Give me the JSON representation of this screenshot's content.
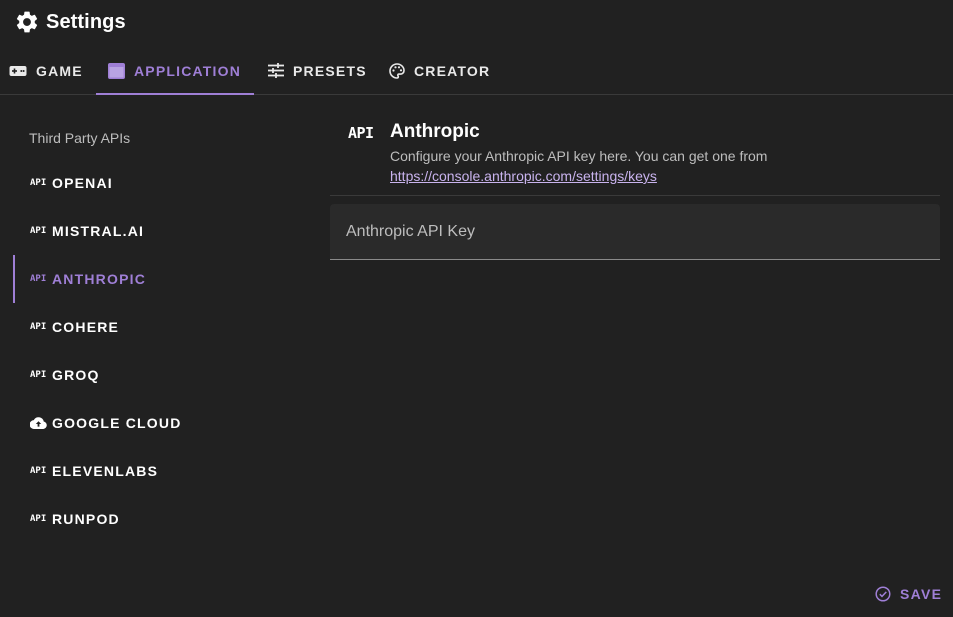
{
  "window": {
    "title": "Settings"
  },
  "tabs": [
    {
      "label": "GAME",
      "icon": "gamepad-icon"
    },
    {
      "label": "APPLICATION",
      "icon": "application-window-icon",
      "active": true
    },
    {
      "label": "PRESETS",
      "icon": "sliders-icon"
    },
    {
      "label": "CREATOR",
      "icon": "palette-icon"
    }
  ],
  "sidebar": {
    "header": "Third Party APIs",
    "items": [
      {
        "label": "OPENAI",
        "icon": "api-icon",
        "icon_text": "API"
      },
      {
        "label": "MISTRAL.AI",
        "icon": "api-icon",
        "icon_text": "API"
      },
      {
        "label": "ANTHROPIC",
        "icon": "api-icon",
        "icon_text": "API",
        "active": true
      },
      {
        "label": "COHERE",
        "icon": "api-icon",
        "icon_text": "API"
      },
      {
        "label": "GROQ",
        "icon": "api-icon",
        "icon_text": "API"
      },
      {
        "label": "GOOGLE CLOUD",
        "icon": "cloud-upload-icon"
      },
      {
        "label": "ELEVENLABS",
        "icon": "api-icon",
        "icon_text": "API"
      },
      {
        "label": "RUNPOD",
        "icon": "api-icon",
        "icon_text": "API"
      }
    ]
  },
  "content": {
    "icon_text": "API",
    "title": "Anthropic",
    "description": "Configure your Anthropic API key here. You can get one from",
    "link": "https://console.anthropic.com/settings/keys",
    "field": {
      "placeholder": "Anthropic API Key",
      "value": ""
    }
  },
  "footer": {
    "save_label": "SAVE"
  },
  "colors": {
    "accent": "#9f7fd6",
    "background": "#212121",
    "field_bg": "#2a2a2a"
  }
}
